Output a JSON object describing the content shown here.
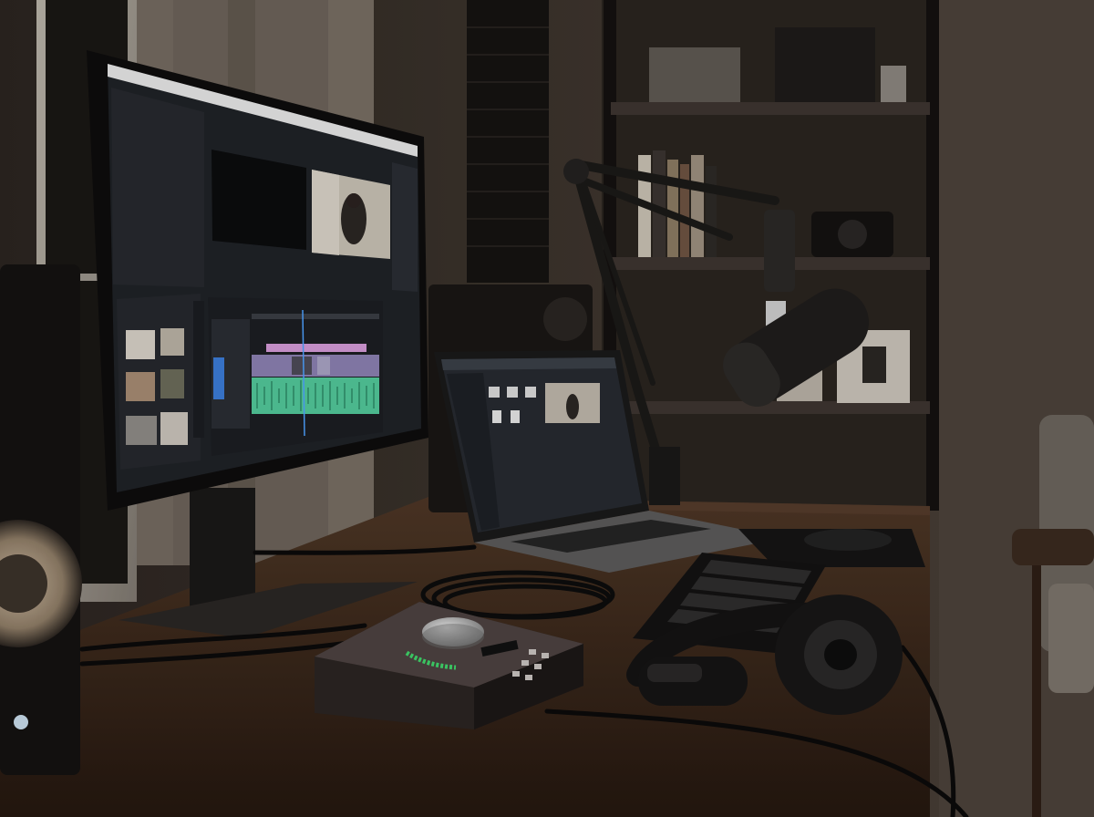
{
  "scene": {
    "description_colors": {
      "wall": "#3b332c",
      "wall_dark": "#241f1b",
      "desk": "#4a3424",
      "desk_dark": "#2d1f15",
      "screen_bg": "#1f2227",
      "panel": "#2a2d33",
      "audio_track": "#52c79a",
      "video_clip": "#8a7fb0",
      "pink_bar": "#d39ad6",
      "blue_strip": "#3b7bd6",
      "meter_green": "#3fd46a"
    }
  }
}
